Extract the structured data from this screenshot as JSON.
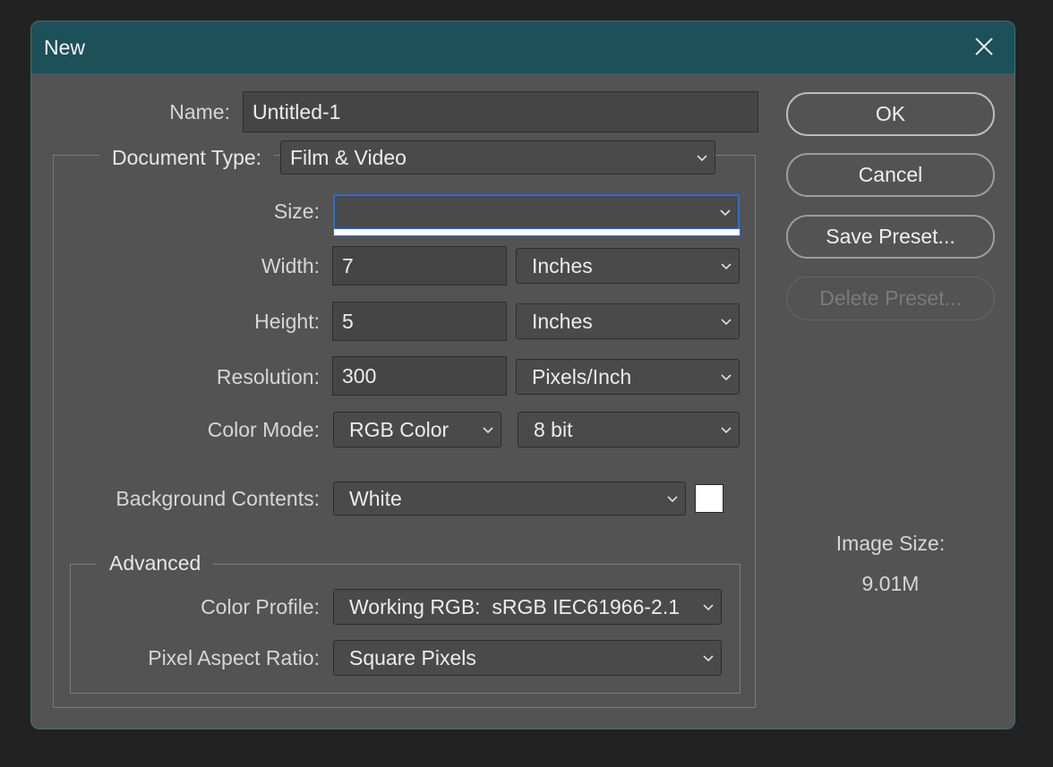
{
  "window": {
    "title": "New"
  },
  "form": {
    "name_label": "Name:",
    "name_value": "Untitled-1",
    "doc_type_label": "Document Type:",
    "doc_type_value": "Film & Video",
    "size_label": "Size:",
    "size_value": "",
    "width_label": "Width:",
    "width_value": "7",
    "width_unit": "Inches",
    "height_label": "Height:",
    "height_value": "5",
    "height_unit": "Inches",
    "resolution_label": "Resolution:",
    "resolution_value": "300",
    "resolution_unit": "Pixels/Inch",
    "color_mode_label": "Color Mode:",
    "color_mode_value": "RGB Color",
    "bit_depth_value": "8 bit",
    "background_label": "Background Contents:",
    "background_value": "White",
    "background_swatch_color": "#ffffff"
  },
  "advanced": {
    "title": "Advanced",
    "color_profile_label": "Color Profile:",
    "color_profile_value": "Working RGB:  sRGB IEC61966-2.1",
    "pixel_aspect_label": "Pixel Aspect Ratio:",
    "pixel_aspect_value": "Square Pixels"
  },
  "buttons": {
    "ok": "OK",
    "cancel": "Cancel",
    "save_preset": "Save Preset...",
    "delete_preset": "Delete Preset..."
  },
  "info": {
    "image_size_label": "Image Size:",
    "image_size_value": "9.01M"
  },
  "colors": {
    "titlebar": "#1c5159",
    "dialog_bg": "#535353",
    "focus_ring": "#2a6fd1"
  }
}
